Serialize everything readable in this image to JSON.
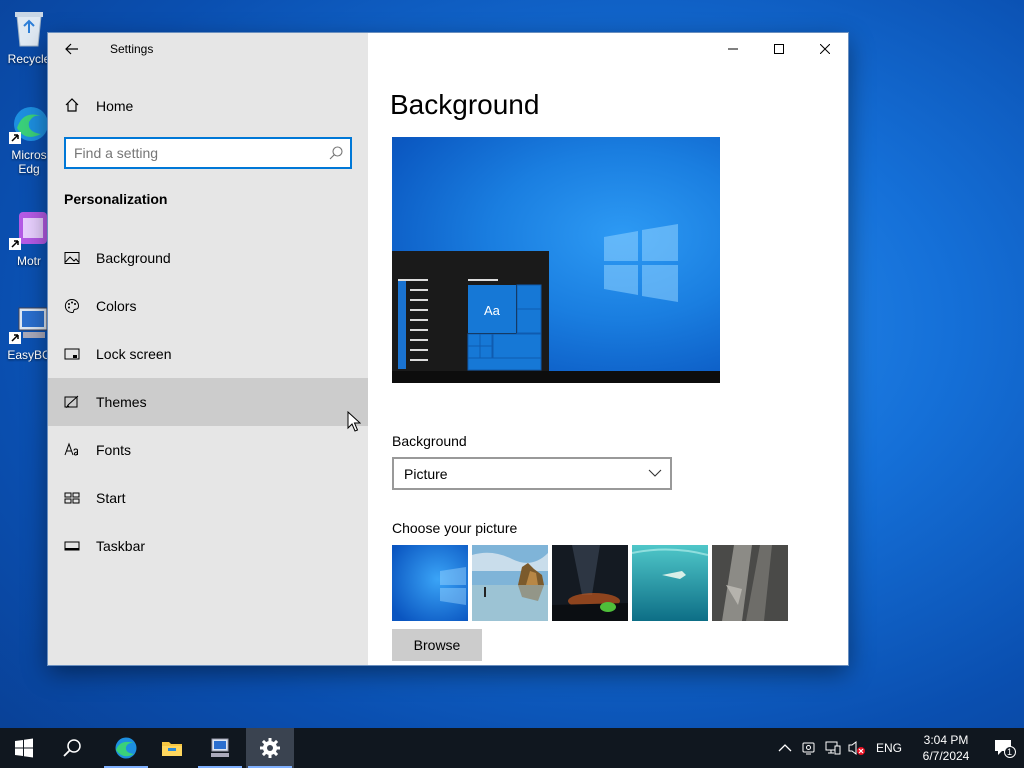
{
  "desktop": {
    "icons": [
      {
        "label": "Recycle",
        "icon": "recycle-bin-icon"
      },
      {
        "label": "Micros\nEdg",
        "label_lines": [
          "Micros",
          "Edg"
        ],
        "icon": "edge-icon"
      },
      {
        "label": "Motr",
        "icon": "app-icon"
      },
      {
        "label": "EasyBC",
        "icon": "easybcd-icon"
      }
    ]
  },
  "window": {
    "title": "Settings",
    "home_label": "Home",
    "search_placeholder": "Find a setting",
    "section": "Personalization",
    "nav": [
      {
        "label": "Background",
        "icon": "picture-icon"
      },
      {
        "label": "Colors",
        "icon": "palette-icon"
      },
      {
        "label": "Lock screen",
        "icon": "lock-screen-icon"
      },
      {
        "label": "Themes",
        "icon": "themes-icon",
        "active": true
      },
      {
        "label": "Fonts",
        "icon": "fonts-icon"
      },
      {
        "label": "Start",
        "icon": "start-icon"
      },
      {
        "label": "Taskbar",
        "icon": "taskbar-icon"
      }
    ]
  },
  "content": {
    "page_title": "Background",
    "preview_tile_text": "Aa",
    "background_label": "Background",
    "background_value": "Picture",
    "choose_label": "Choose your picture",
    "browse_label": "Browse"
  },
  "taskbar": {
    "language": "ENG",
    "time": "3:04 PM",
    "date": "6/7/2024",
    "notification_count": "1"
  },
  "colors": {
    "accent": "#0078d7",
    "sidebar": "#e6e6e6",
    "selected": "#cccccc",
    "taskbar": "#10171f"
  }
}
